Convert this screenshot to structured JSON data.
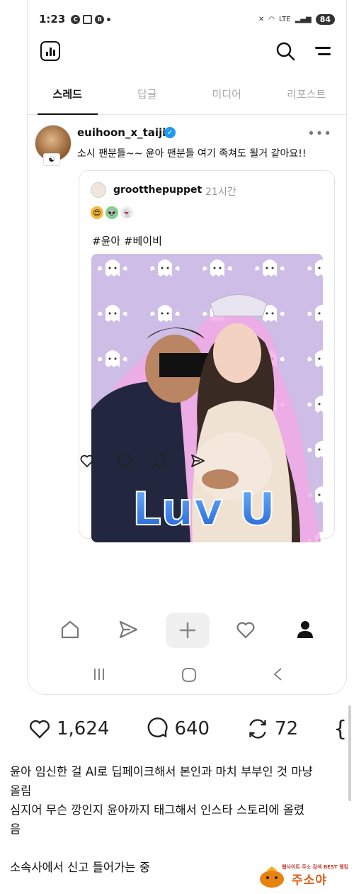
{
  "status_bar": {
    "time": "1:23",
    "left_icons": [
      "C",
      "",
      "B"
    ],
    "network": "LTE",
    "battery": "84"
  },
  "tabs": [
    {
      "label": "스레드",
      "active": true
    },
    {
      "label": "답글",
      "active": false
    },
    {
      "label": "미디어",
      "active": false
    },
    {
      "label": "리포스트",
      "active": false
    }
  ],
  "post": {
    "username": "euihoon_x_taiji",
    "text": "소시 팬분들~~ 윤아 팬분들 여기 족쳐도 될거 같아요!!",
    "quoted": {
      "username": "grootthepuppet",
      "time": "21시간",
      "hashtags": "#윤아 #베이비",
      "image_text": "Luv U"
    }
  },
  "stats": {
    "likes": "1,624",
    "comments": "640",
    "reposts": "72"
  },
  "caption": {
    "line1": "윤아 임신한 걸 AI로 딥페이크해서 본인과 마치 부부인 것 마냥",
    "line2": "올림",
    "line3": "심지어 무슨 깡인지 윤아까지 태그해서 인스타 스토리에 올렸",
    "line4": "음",
    "line5": "소속사에서 신고 들어가는 중"
  },
  "watermark": {
    "tagline": "웹사이트 주소 검색 BEST 랭킹",
    "name": "주소야"
  },
  "colors": {
    "verified": "#1d9bf0",
    "card_bg": "#cdbde7",
    "glitter_text": "#2f7fe8"
  }
}
